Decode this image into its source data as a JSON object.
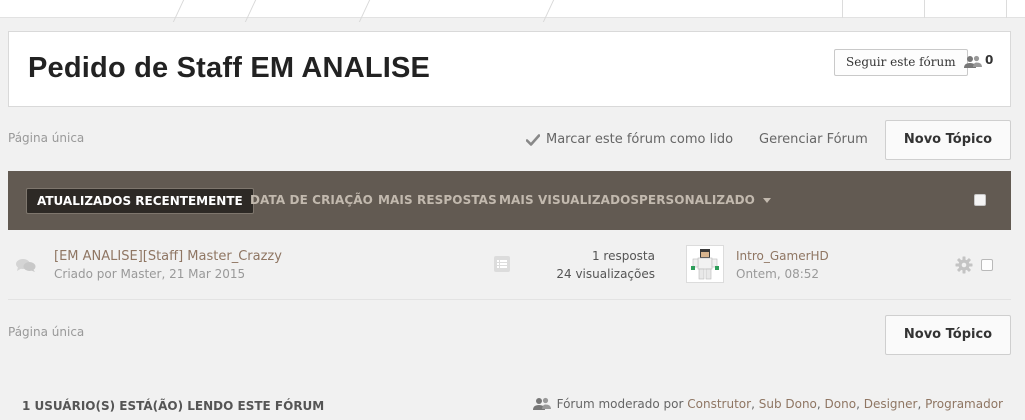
{
  "header": {
    "title": "Pedido de Staff EM ANALISE",
    "follow_label": "Seguir este fórum",
    "followers_count": "0"
  },
  "pagination_top": "Página única",
  "pagination_bottom": "Página única",
  "actions": {
    "mark_read": "Marcar este fórum como lido",
    "manage": "Gerenciar Fórum",
    "new_topic": "Novo Tópico"
  },
  "sort_tabs": {
    "active": "ATUALIZADOS RECENTEMENTE",
    "creation": "DATA DE CRIAÇÃO",
    "replies": "MAIS RESPOSTAS",
    "views": "MAIS VISUALIZADOS",
    "custom": "PERSONALIZADO"
  },
  "topics": [
    {
      "title": "[EM ANALISE][Staff] Master_Crazzy",
      "meta": "Criado por Master, 21 Mar 2015",
      "replies": "1 resposta",
      "views": "24 visualizações",
      "last_user": "Intro_GamerHD",
      "last_time": "Ontem, 08:52"
    }
  ],
  "footer": {
    "readers": "1 USUÁRIO(S) ESTÁ(ÃO) LENDO ESTE FÓRUM",
    "moderated_prefix": "Fórum moderado por",
    "moderators": [
      "Construtor",
      "Sub Dono",
      "Dono",
      "Designer",
      "Programador"
    ]
  },
  "colors": {
    "sortbar": "#625a52",
    "link": "#8f7663",
    "active_tab": "#2d2925"
  },
  "icons": {
    "followers": "people-icon",
    "mark_read": "checkmark-icon",
    "topic": "chat-bubbles-icon",
    "preview": "list-icon",
    "row_options": "gear-icon"
  }
}
